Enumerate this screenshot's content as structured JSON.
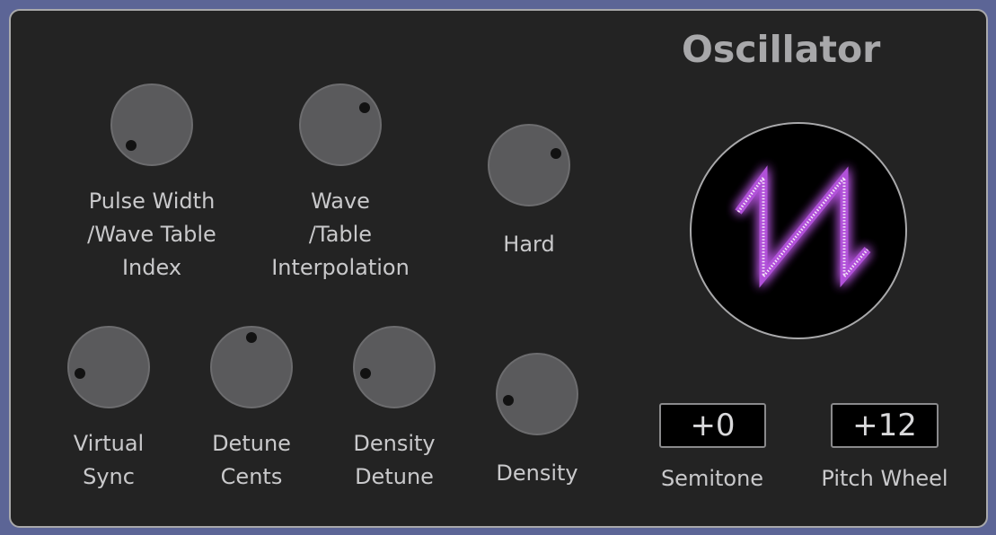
{
  "panel": {
    "title": "Oscillator"
  },
  "knobs": {
    "pulse_width": {
      "label_lines": [
        "Pulse Width",
        "/Wave Table",
        "Index"
      ],
      "value": 0.0
    },
    "wave_interpolation": {
      "label_lines": [
        "Wave",
        "/Table",
        "Interpolation"
      ],
      "value": 0.7
    },
    "hard": {
      "label_lines": [
        "Hard"
      ],
      "value": 0.75
    },
    "virtual_sync": {
      "label_lines": [
        "Virtual",
        "Sync"
      ],
      "value": 0.12
    },
    "detune_cents": {
      "label_lines": [
        "Detune",
        "Cents"
      ],
      "value": 0.5
    },
    "density_detune": {
      "label_lines": [
        "Density",
        "Detune"
      ],
      "value": 0.12
    },
    "density": {
      "label_lines": [
        "Density"
      ],
      "value": 0.12
    }
  },
  "wave_display": {
    "waveform": "sawtooth",
    "glow_color": "#e070ff"
  },
  "semitone": {
    "value": "+0",
    "label": "Semitone"
  },
  "pitch_wheel": {
    "value": "+12",
    "label": "Pitch Wheel"
  },
  "colors": {
    "background": "#5c6596",
    "panel": "#232323",
    "knob": "#5a5a5c",
    "text": "#c9c9cb",
    "title": "#a8a8aa"
  }
}
